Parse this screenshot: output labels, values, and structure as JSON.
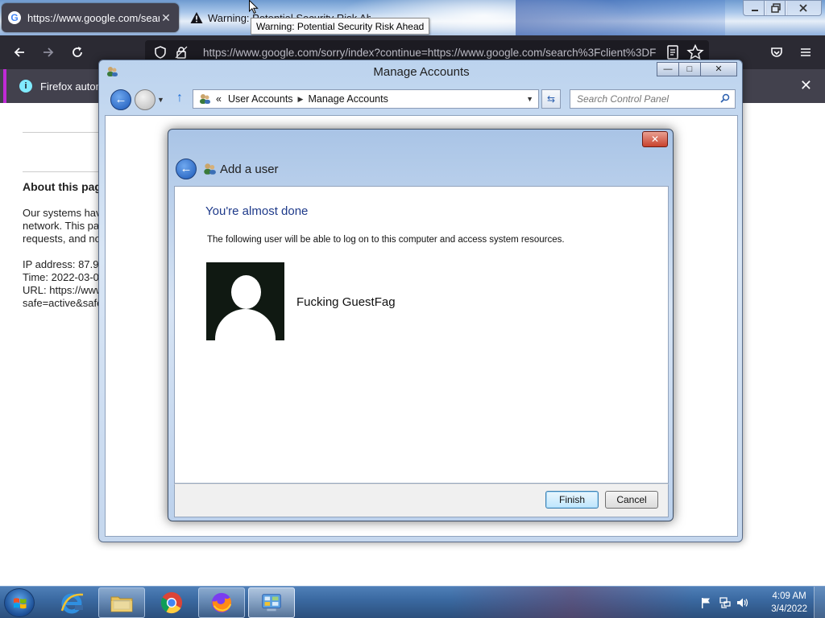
{
  "browser": {
    "tabs": [
      {
        "title": "https://www.google.com/search",
        "close": "✕"
      },
      {
        "title": "Warning: Potential Security Risk Ahead"
      }
    ],
    "tooltip": "Warning: Potential Security Risk Ahead",
    "url": "https://www.google.com/sorry/index?continue=https://www.google.com/search%3Fclient%3DF",
    "notice": "Firefox automa",
    "icons": {
      "back": "arrow-left-icon",
      "forward": "arrow-right-icon",
      "reload": "reload-icon",
      "shield": "shield-icon",
      "lock": "lock-icon",
      "reader": "reader-view-icon",
      "bookmark": "star-icon",
      "pocket": "pocket-icon",
      "menu": "hamburger-icon"
    }
  },
  "page": {
    "about_heading": "About this page",
    "lines": [
      "Our systems have",
      "network. This pa",
      "requests, and no",
      "",
      "IP address: 87.9",
      "Time: 2022-03-0",
      "URL: https://www",
      "safe=active&safe"
    ]
  },
  "manage_accounts": {
    "title": "Manage Accounts",
    "breadcrumb": {
      "prefix": "«",
      "parent": "User Accounts",
      "current": "Manage Accounts"
    },
    "search_placeholder": "Search Control Panel",
    "controls": {
      "minimize": "—",
      "maximize": "□",
      "close": "✕"
    }
  },
  "dialog": {
    "title": "Add a user",
    "heading": "You're almost done",
    "description": "The following user will be able to log on to this computer and access system resources.",
    "user_name": "Fucking GuestFag",
    "buttons": {
      "finish": "Finish",
      "cancel": "Cancel"
    },
    "close": "✕"
  },
  "taskbar": {
    "time": "4:09 AM",
    "date": "3/4/2022",
    "apps": [
      "internet-explorer",
      "windows-explorer",
      "chrome",
      "firefox",
      "control-panel"
    ]
  },
  "colors": {
    "firefox_dark": "#2b2a33",
    "dialog_heading": "#1e3a8a",
    "aero_blue": "#bcd3ee"
  }
}
